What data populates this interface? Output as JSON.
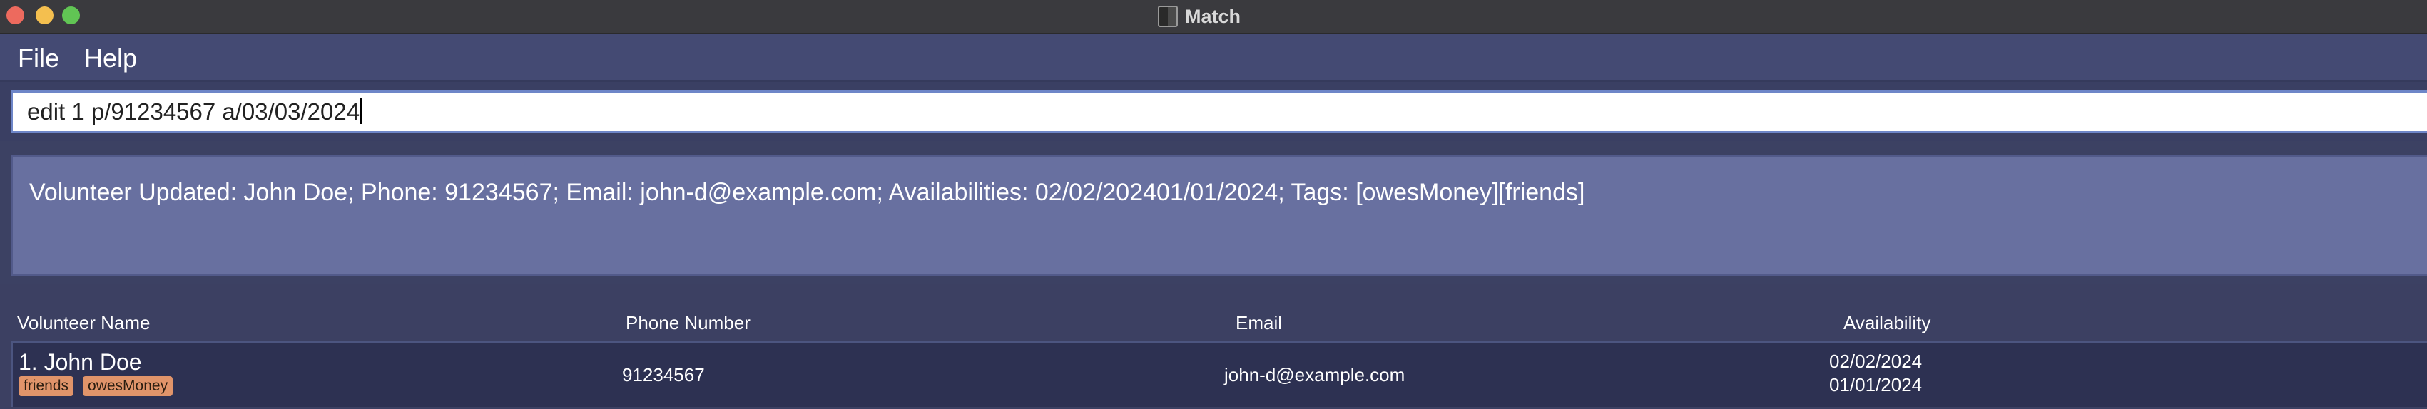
{
  "window": {
    "title": "Match"
  },
  "menu": {
    "file": "File",
    "help": "Help"
  },
  "command": {
    "value": "edit 1 p/91234567 a/03/03/2024"
  },
  "result": {
    "text": "Volunteer Updated: John Doe; Phone: 91234567; Email: john-d@example.com; Availabilities: 02/02/202401/01/2024; Tags: [owesMoney][friends]"
  },
  "table": {
    "headers": [
      "Volunteer Name",
      "Phone Number",
      "Email",
      "Availability"
    ],
    "rows": [
      {
        "name": "1. John Doe",
        "tags": [
          "friends",
          "owesMoney"
        ],
        "phone": "91234567",
        "email": "john-d@example.com",
        "availability": [
          "02/02/2024",
          "01/01/2024"
        ]
      }
    ]
  },
  "colors": {
    "window_background": "#3c4060",
    "menubar": "#444a73",
    "result_box": "#6870a0",
    "row_background": "#2d3152",
    "tag": "#e0946a"
  }
}
